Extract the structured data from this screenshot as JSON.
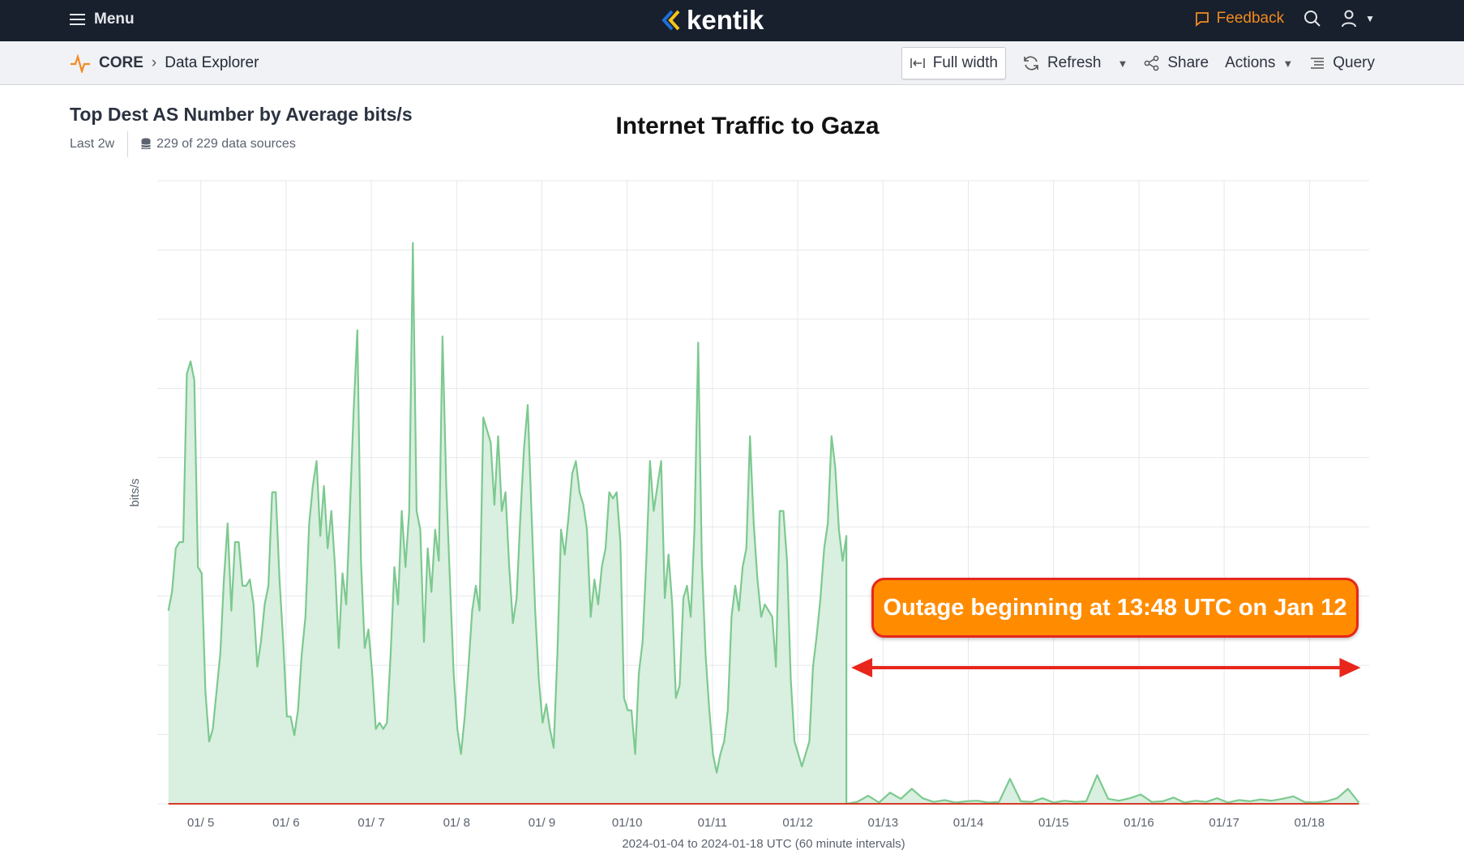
{
  "header": {
    "menu_label": "Menu",
    "logo_text": "kentik",
    "feedback_label": "Feedback"
  },
  "subbar": {
    "breadcrumb_root": "CORE",
    "breadcrumb_page": "Data Explorer",
    "full_width_label": "Full width",
    "refresh_label": "Refresh",
    "share_label": "Share",
    "actions_label": "Actions",
    "query_label": "Query"
  },
  "panel": {
    "title": "Top Dest AS Number by Average bits/s",
    "time_range": "Last 2w",
    "data_sources": "229 of 229 data sources"
  },
  "colors": {
    "header_bg": "#18202e",
    "accent": "#f28a1f",
    "series": "#7cc98f",
    "series_fill": "#d9efdf",
    "baseline": "#d63b2a",
    "annotation": "#ff8c00",
    "arrow": "#e8261b"
  },
  "chart_data": {
    "type": "area",
    "title": "Internet Traffic to Gaza",
    "xlabel": "2024-01-04 to 2024-01-18 UTC (60 minute intervals)",
    "ylabel": "bits/s",
    "x_units": "day of January 2024",
    "xlim": [
      4.49,
      18.7
    ],
    "ylim": [
      0,
      100
    ],
    "y_units": "relative (percent of axis max, no tick labels shown)",
    "grid": true,
    "x_ticks": [
      {
        "day": 5,
        "label": "01/ 5"
      },
      {
        "day": 6,
        "label": "01/ 6"
      },
      {
        "day": 7,
        "label": "01/ 7"
      },
      {
        "day": 8,
        "label": "01/ 8"
      },
      {
        "day": 9,
        "label": "01/ 9"
      },
      {
        "day": 10,
        "label": "01/10"
      },
      {
        "day": 11,
        "label": "01/11"
      },
      {
        "day": 12,
        "label": "01/12"
      },
      {
        "day": 13,
        "label": "01/13"
      },
      {
        "day": 14,
        "label": "01/14"
      },
      {
        "day": 15,
        "label": "01/15"
      },
      {
        "day": 16,
        "label": "01/16"
      },
      {
        "day": 17,
        "label": "01/17"
      },
      {
        "day": 18,
        "label": "01/18"
      }
    ],
    "y_grid_count": 9,
    "pre_outage": {
      "start_day": 4.62,
      "end_day": 12.57,
      "values": [
        31,
        34,
        41,
        42,
        42,
        69,
        71,
        68,
        38,
        37,
        18,
        10,
        12,
        18,
        24,
        36,
        45,
        31,
        42,
        42,
        35,
        35,
        36,
        32,
        22,
        26,
        32,
        35,
        50,
        50,
        36,
        26,
        14,
        14,
        11,
        15,
        24,
        30,
        45,
        51,
        55,
        43,
        51,
        41,
        47,
        38,
        25,
        37,
        32,
        47,
        63,
        76,
        39,
        25,
        28,
        21,
        12,
        13,
        12,
        13,
        24,
        38,
        32,
        47,
        38,
        47,
        90,
        47,
        44,
        26,
        41,
        34,
        44,
        39,
        75,
        51,
        36,
        21,
        12,
        8,
        14,
        22,
        31,
        35,
        31,
        62,
        60,
        58,
        48,
        59,
        47,
        50,
        38,
        29,
        33,
        46,
        57,
        64,
        47,
        31,
        20,
        13,
        16,
        12,
        9,
        24,
        44,
        40,
        46,
        53,
        55,
        50,
        48,
        44,
        30,
        36,
        32,
        38,
        41,
        50,
        49,
        50,
        42,
        17,
        15,
        15,
        8,
        21,
        26,
        39,
        55,
        47,
        51,
        55,
        33,
        40,
        32,
        17,
        19,
        33,
        35,
        30,
        44,
        74,
        39,
        24,
        15,
        8,
        5,
        8,
        10,
        15,
        30,
        35,
        31,
        38,
        41,
        59,
        45,
        36,
        30,
        32,
        31,
        30,
        22,
        47,
        47,
        39,
        20,
        10,
        8,
        6,
        8,
        10,
        22,
        27,
        33,
        41,
        45,
        59,
        54,
        44,
        39,
        43
      ]
    },
    "post_outage": {
      "start_day": 12.57,
      "end_day": 18.58,
      "values": [
        0,
        0.3,
        1.3,
        0.2,
        1.8,
        0.8,
        2.4,
        0.9,
        0.3,
        0.6,
        0.2,
        0.4,
        0.5,
        0.2,
        0.3,
        4,
        0.4,
        0.3,
        0.9,
        0.2,
        0.5,
        0.3,
        0.4,
        4.6,
        0.8,
        0.5,
        0.9,
        1.5,
        0.3,
        0.4,
        1,
        0.2,
        0.5,
        0.3,
        0.9,
        0.2,
        0.6,
        0.4,
        0.7,
        0.5,
        0.8,
        1.2,
        0.3,
        0.2,
        0.4,
        0.9,
        2.4,
        0.2
      ]
    },
    "annotation": {
      "text": "Outage beginning at 13:48 UTC on Jan 12",
      "arrow_from_day": 12.57,
      "arrow_to_day": 18.6
    }
  }
}
